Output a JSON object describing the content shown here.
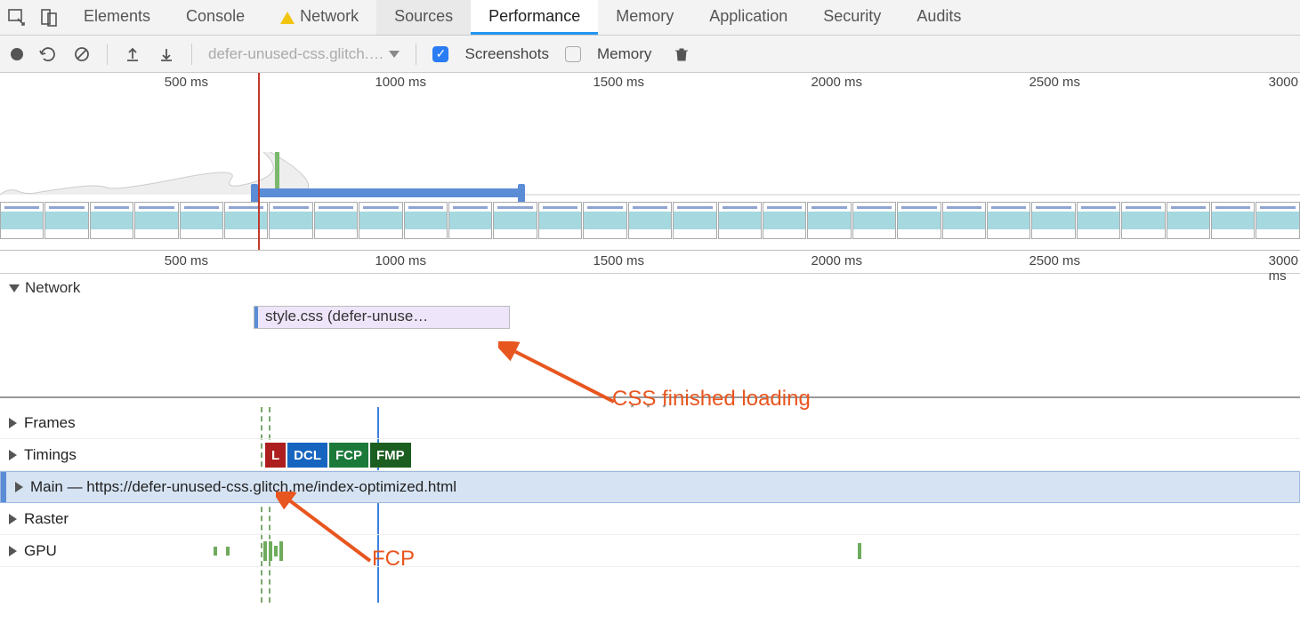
{
  "tabs": {
    "elements": "Elements",
    "console": "Console",
    "network": "Network",
    "sources": "Sources",
    "performance": "Performance",
    "memory": "Memory",
    "application": "Application",
    "security": "Security",
    "audits": "Audits"
  },
  "toolbar": {
    "dropdown": "defer-unused-css.glitch.…",
    "screenshots_label": "Screenshots",
    "memory_label": "Memory"
  },
  "ruler": {
    "t1": "500 ms",
    "t2": "1000 ms",
    "t3": "1500 ms",
    "t4": "2000 ms",
    "t5": "2500 ms",
    "t6a": "3000",
    "t6b": "3000 ms"
  },
  "sections": {
    "network": "Network",
    "frames": "Frames",
    "timings": "Timings",
    "main": "Main — https://defer-unused-css.glitch.me/index-optimized.html",
    "raster": "Raster",
    "gpu": "GPU"
  },
  "net": {
    "bar": "style.css (defer-unuse…"
  },
  "badges": {
    "l": "L",
    "dcl": "DCL",
    "fcp": "FCP",
    "fmp": "FMP"
  },
  "annotations": {
    "css": "CSS finished loading",
    "fcp": "FCP"
  }
}
